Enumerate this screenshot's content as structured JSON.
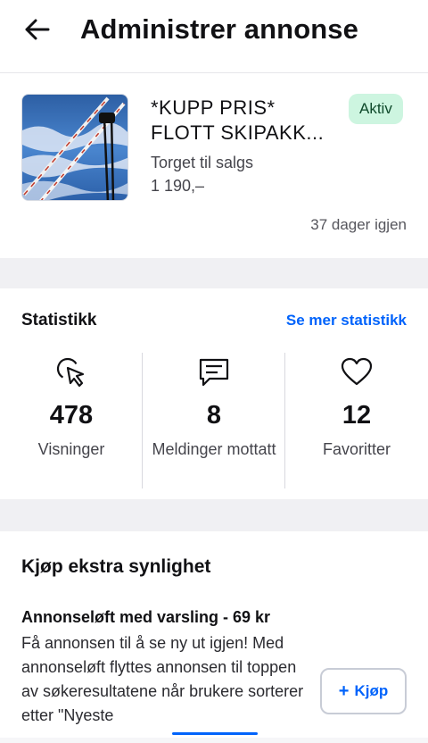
{
  "header": {
    "title": "Administrer annonse",
    "back_icon": "arrow-left-icon"
  },
  "ad": {
    "title": "*KUPP PRIS* FLOTT SKIPAKK...",
    "status": "Aktiv",
    "category": "Torget til salgs",
    "price": "1 190,–",
    "days_left": "37 dager igjen",
    "status_color": "#cdf5e0"
  },
  "stats": {
    "title": "Statistikk",
    "link": "Se mer statistikk",
    "items": [
      {
        "icon": "cursor-click-icon",
        "value": "478",
        "label": "Visninger"
      },
      {
        "icon": "message-icon",
        "value": "8",
        "label": "Meldinger mottatt"
      },
      {
        "icon": "heart-icon",
        "value": "12",
        "label": "Favoritter"
      }
    ]
  },
  "promo": {
    "title": "Kjøp ekstra synlighet",
    "offer_title": "Annonseløft med varsling - 69 kr",
    "offer_desc": "Få annonsen til å se ny ut igjen! Med annonseløft flyttes annonsen til toppen av søkeresultatene når brukere sorterer etter \"Nyeste",
    "buy_label": "Kjøp",
    "buy_icon": "plus-icon"
  },
  "colors": {
    "accent": "#0063fb",
    "background_gap": "#f0f0f3"
  }
}
